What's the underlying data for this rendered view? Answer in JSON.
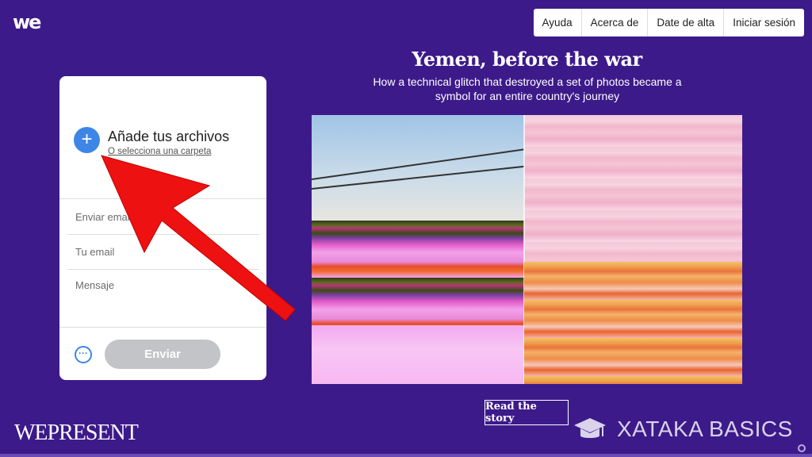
{
  "brand": {
    "logo_text": "we"
  },
  "nav": {
    "items": [
      "Ayuda",
      "Acerca de",
      "Date de alta",
      "Iniciar sesión"
    ]
  },
  "story": {
    "title": "Yemen, before the war",
    "subtitle": "How a technical glitch that destroyed a set of photos became a symbol for an entire country's journey",
    "read_button": "Read the story"
  },
  "panel": {
    "add_title": "Añade tus archivos",
    "add_folder_link": "O selecciona una carpeta",
    "send_email_placeholder": "Enviar email a",
    "your_email_placeholder": "Tu email",
    "message_placeholder": "Mensaje",
    "more_icon": "ellipsis-icon",
    "send_button": "Enviar"
  },
  "footer": {
    "wepresent": "WEPRESENT",
    "watermark": "XATAKA BASICS"
  },
  "colors": {
    "background": "#3d1a8a",
    "accent_blue": "#3d86e6",
    "send_disabled": "#c2c4c7",
    "annotation_arrow": "#ee1111"
  }
}
